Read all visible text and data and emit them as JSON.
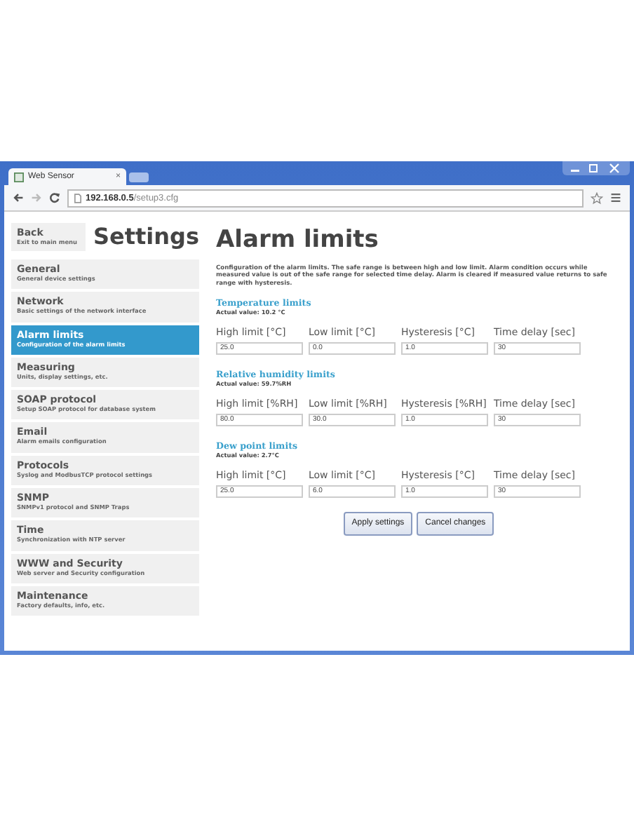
{
  "browser": {
    "tab_title": "Web Sensor",
    "tab_close": "×",
    "url_host": "192.168.0.5",
    "url_path": "/setup3.cfg"
  },
  "back": {
    "label": "Back",
    "sublabel": "Exit to main menu"
  },
  "sidebar_title": "Settings",
  "menu": [
    {
      "label": "General",
      "sublabel": "General device settings",
      "selected": false
    },
    {
      "label": "Network",
      "sublabel": "Basic settings of the network interface",
      "selected": false
    },
    {
      "label": "Alarm limits",
      "sublabel": "Configuration of the alarm limits",
      "selected": true
    },
    {
      "label": "Measuring",
      "sublabel": "Units, display settings, etc.",
      "selected": false
    },
    {
      "label": "SOAP protocol",
      "sublabel": "Setup SOAP protocol for database system",
      "selected": false
    },
    {
      "label": "Email",
      "sublabel": "Alarm emails configuration",
      "selected": false
    },
    {
      "label": "Protocols",
      "sublabel": "Syslog and ModbusTCP protocol settings",
      "selected": false
    },
    {
      "label": "SNMP",
      "sublabel": "SNMPv1 protocol and SNMP Traps",
      "selected": false
    },
    {
      "label": "Time",
      "sublabel": "Synchronization with NTP server",
      "selected": false
    },
    {
      "label": "WWW and Security",
      "sublabel": "Web server and Security configuration",
      "selected": false
    },
    {
      "label": "Maintenance",
      "sublabel": "Factory defaults, info, etc.",
      "selected": false
    }
  ],
  "heading": "Alarm limits",
  "description": "Configuration of the alarm limits. The safe range is between high and low limit. Alarm condition occurs while measured value is out of the safe range for selected time delay. Alarm is cleared if measured value returns to safe range with hysteresis.",
  "sections": [
    {
      "title": "Temperature limits",
      "actual": "Actual value: 10.2 °C",
      "fields": [
        {
          "label": "High limit [°C]",
          "value": "25.0"
        },
        {
          "label": "Low limit [°C]",
          "value": "0.0"
        },
        {
          "label": "Hysteresis [°C]",
          "value": "1.0"
        },
        {
          "label": "Time delay [sec]",
          "value": "30"
        }
      ]
    },
    {
      "title": "Relative humidity limits",
      "actual": "Actual value: 59.7%RH",
      "fields": [
        {
          "label": "High limit [%RH]",
          "value": "80.0"
        },
        {
          "label": "Low limit [%RH]",
          "value": "30.0"
        },
        {
          "label": "Hysteresis [%RH]",
          "value": "1.0"
        },
        {
          "label": "Time delay [sec]",
          "value": "30"
        }
      ]
    },
    {
      "title": "Dew point limits",
      "actual": "Actual value: 2.7°C",
      "fields": [
        {
          "label": "High limit [°C]",
          "value": "25.0"
        },
        {
          "label": "Low limit [°C]",
          "value": "6.0"
        },
        {
          "label": "Hysteresis [°C]",
          "value": "1.0"
        },
        {
          "label": "Time delay [sec]",
          "value": "30"
        }
      ]
    }
  ],
  "buttons": [
    "Apply settings",
    "Cancel changes"
  ]
}
